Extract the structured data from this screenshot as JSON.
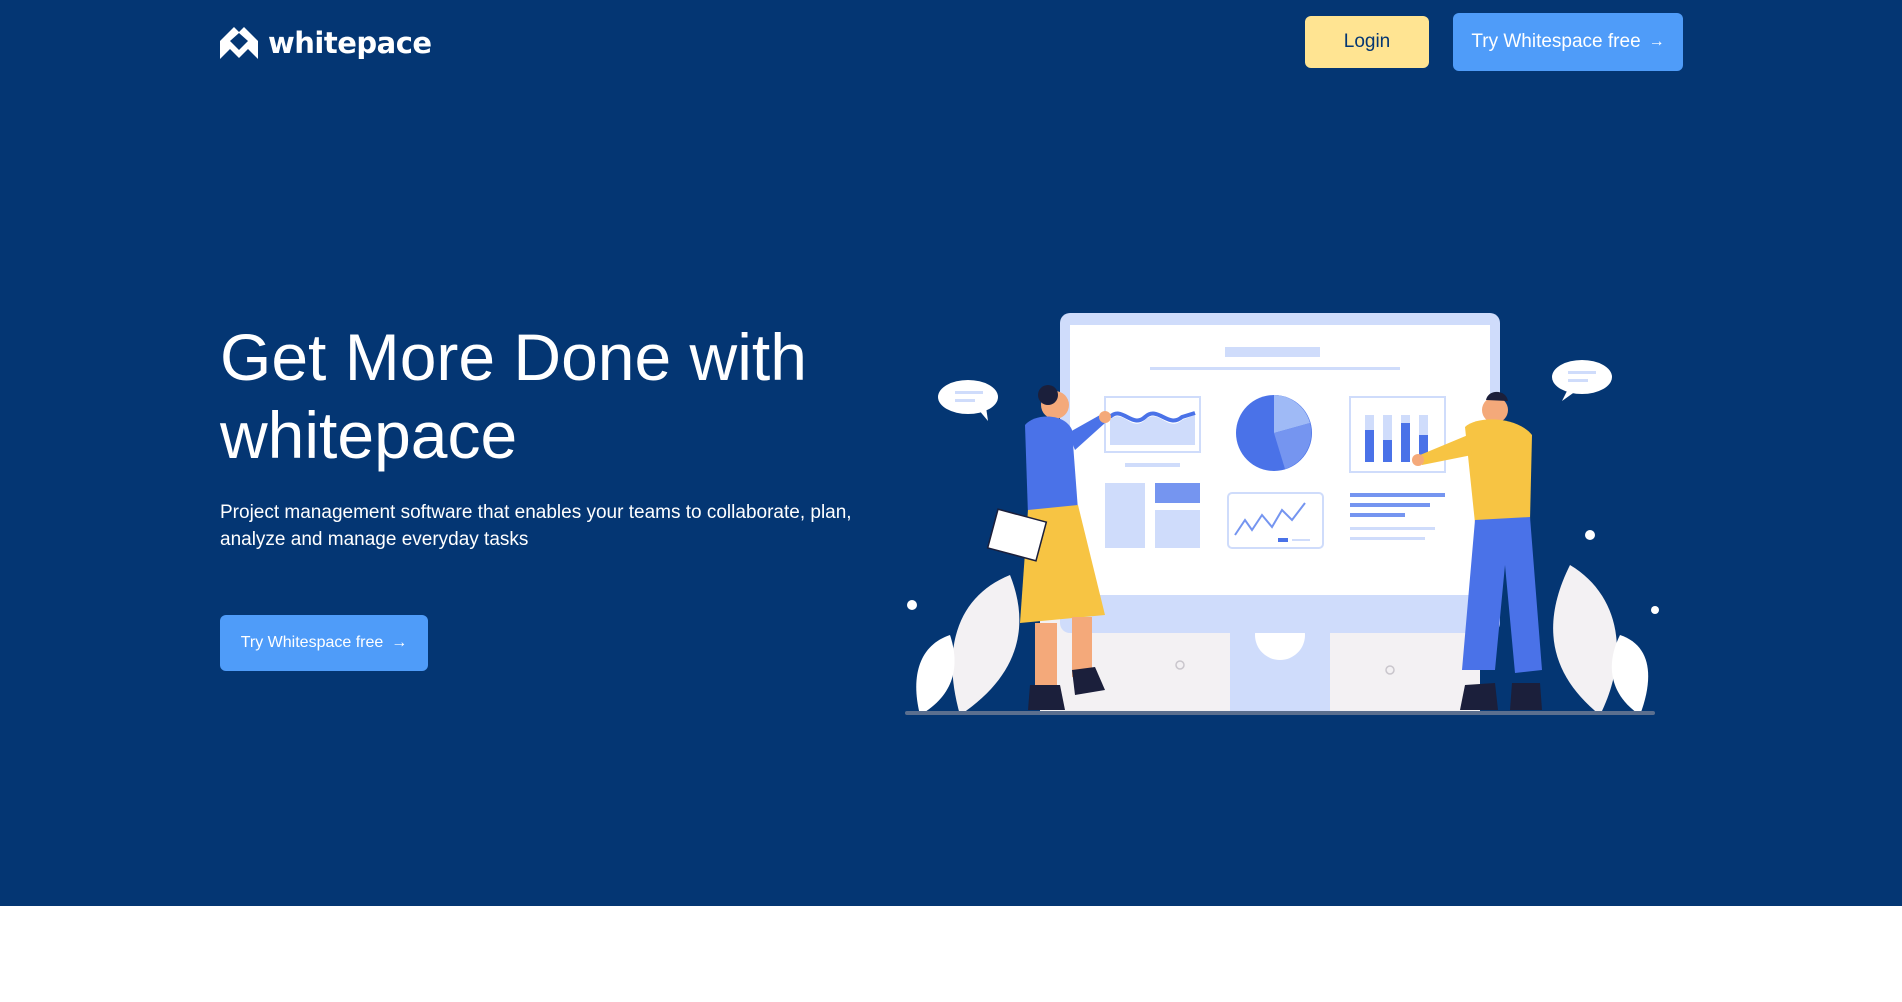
{
  "brand": {
    "name": "whitepace",
    "logo_icon": "whitepace-logo-icon"
  },
  "nav": {
    "login_label": "Login",
    "try_label": "Try Whitespace free",
    "try_icon": "arrow-right-icon"
  },
  "hero": {
    "headline": "Get More Done with whitepace",
    "subtext": "Project management software that enables your teams to collaborate, plan, analyze and manage everyday tasks",
    "cta_label": "Try Whitespace free",
    "cta_icon": "arrow-right-icon",
    "illustration": "team-dashboard-illustration"
  },
  "colors": {
    "hero_bg": "#043673",
    "accent_blue": "#4f9cf9",
    "login_yellow": "#ffe492",
    "text_white": "#ffffff"
  }
}
